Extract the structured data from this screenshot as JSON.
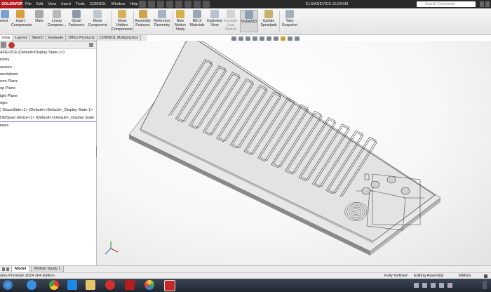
{
  "titlebar": {
    "logo": "SOLIDWORKS",
    "menus": [
      "File",
      "Edit",
      "View",
      "Insert",
      "Tools",
      "COMSOL",
      "Window",
      "Help"
    ],
    "document_title": "ELSIADEVICE.SLDASM",
    "search_placeholder": "Search Commands"
  },
  "ribbon": {
    "buttons": [
      {
        "label": "Edit Component",
        "display": "ment"
      },
      {
        "label": "Insert Components",
        "display": "Insert\nComponents"
      },
      {
        "label": "Mate",
        "display": "Mate"
      },
      {
        "label": "Linear Component...",
        "display": "Linear\nCompone..."
      },
      {
        "label": "Smart Fasteners",
        "display": "Smart\nFasteners"
      },
      {
        "label": "Move Component",
        "display": "Move\nComponent"
      },
      {
        "label": "Show Hidden Components",
        "display": "Show\nHidden\nComponents"
      },
      {
        "label": "Assembly Features",
        "display": "Assembly\nFeatures"
      },
      {
        "label": "Reference Geometry",
        "display": "Reference\nGeometry"
      },
      {
        "label": "New Motion Study",
        "display": "New\nMotion\nStudy"
      },
      {
        "label": "Bill of Materials",
        "display": "Bill of\nMaterials"
      },
      {
        "label": "Exploded View",
        "display": "Exploded\nView"
      },
      {
        "label": "Explode Line Sketch",
        "display": "Explode\nLine\nSketch"
      },
      {
        "label": "Instant3D",
        "display": "Instant3D"
      },
      {
        "label": "Update Speedpak",
        "display": "Update\nSpeedpak"
      },
      {
        "label": "Take Snapshot",
        "display": "Take\nSnapshot"
      }
    ]
  },
  "command_tabs": [
    "mbly",
    "Layout",
    "Sketch",
    "Evaluate",
    "Office Products",
    "COMSOL Multiphysics"
  ],
  "feature_tree": {
    "items": [
      "ADEVICE  (Default<Display State-1>)",
      "istory",
      "ensors",
      "nnotations",
      "ront Plane",
      "op Plane",
      "ight Plane",
      "rigin",
      ") GlassSlide<1> (Default<<Default>_Display State 1>",
      "DMSpart device<1> (Default<<Default>_Display State",
      "tates"
    ]
  },
  "bottom_tabs": [
    "Model",
    "Motion Study 1"
  ],
  "status_bar": {
    "product": "orks Premium 2014 x64 Edition",
    "state": "Fully Defined",
    "mode": "Editing Assembly",
    "units": "MMGS"
  },
  "colors": {
    "brand": "#b3191f",
    "titlebar_bg": "#2b2b2b",
    "ribbon_bg": "#ececec",
    "part_face": "#e6e6e6",
    "part_edge": "#3a3a3a",
    "slide_side": "#a8a8a8",
    "taskbar_bg": "#2a3240"
  },
  "taskbar": {
    "icons": [
      "start-orb",
      "internet-explorer",
      "chrome",
      "dropbox",
      "file-explorer",
      "netease-music",
      "media-player",
      "photo-viewer",
      "solidworks"
    ]
  }
}
